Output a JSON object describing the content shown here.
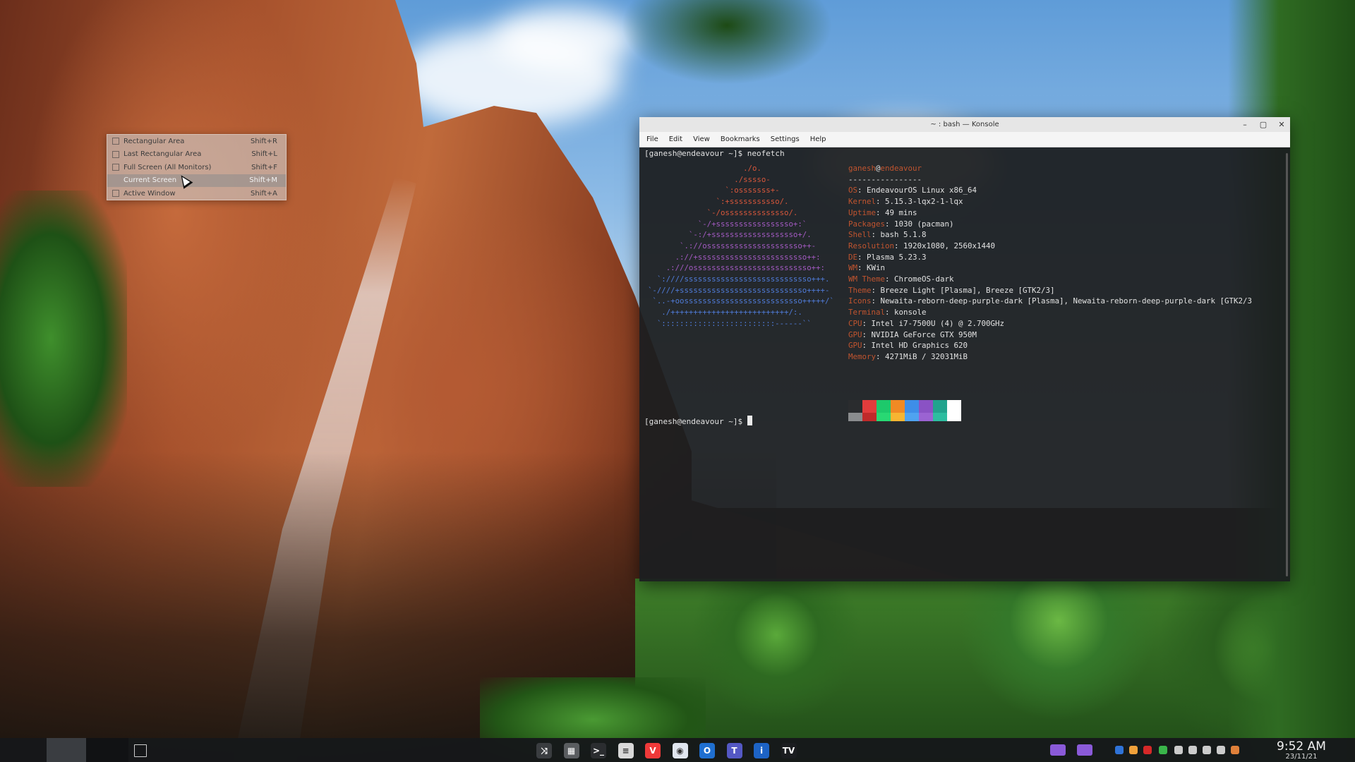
{
  "spectacle_menu": {
    "items": [
      {
        "label": "Rectangular Area",
        "shortcut": "Shift+R"
      },
      {
        "label": "Last Rectangular Area",
        "shortcut": "Shift+L"
      },
      {
        "label": "Full Screen (All Monitors)",
        "shortcut": "Shift+F"
      },
      {
        "label": "Current Screen",
        "shortcut": "Shift+M",
        "highlighted": true
      },
      {
        "label": "Active Window",
        "shortcut": "Shift+A"
      }
    ]
  },
  "konsole": {
    "title": "~ : bash — Konsole",
    "menu": [
      "File",
      "Edit",
      "View",
      "Bookmarks",
      "Settings",
      "Help"
    ],
    "prompt1": "[ganesh@endeavour ~]$ neofetch",
    "prompt2": "[ganesh@endeavour ~]$ ",
    "user": "ganesh",
    "host": "endeavour",
    "separator": "----------------",
    "info": [
      {
        "key": "OS",
        "value": "EndeavourOS Linux x86_64"
      },
      {
        "key": "Kernel",
        "value": "5.15.3-lqx2-1-lqx"
      },
      {
        "key": "Uptime",
        "value": "49 mins"
      },
      {
        "key": "Packages",
        "value": "1030 (pacman)"
      },
      {
        "key": "Shell",
        "value": "bash 5.1.8"
      },
      {
        "key": "Resolution",
        "value": "1920x1080, 2560x1440"
      },
      {
        "key": "DE",
        "value": "Plasma 5.23.3"
      },
      {
        "key": "WM",
        "value": "KWin"
      },
      {
        "key": "WM Theme",
        "value": "ChromeOS-dark"
      },
      {
        "key": "Theme",
        "value": "Breeze Light [Plasma], Breeze [GTK2/3]"
      },
      {
        "key": "Icons",
        "value": "Newaita-reborn-deep-purple-dark [Plasma], Newaita-reborn-deep-purple-dark [GTK2/3"
      },
      {
        "key": "Terminal",
        "value": "konsole"
      },
      {
        "key": "CPU",
        "value": "Intel i7-7500U (4) @ 2.700GHz"
      },
      {
        "key": "GPU",
        "value": "NVIDIA GeForce GTX 950M"
      },
      {
        "key": "GPU",
        "value": "Intel HD Graphics 620"
      },
      {
        "key": "Memory",
        "value": "4271MiB / 32031MiB"
      }
    ],
    "ascii_art": [
      "                     ./o.",
      "                   ./sssso-",
      "                 `:osssssss+-",
      "               `:+sssssssssso/.",
      "             `-/ossssssssssssso/.",
      "           `-/+sssssssssssssssso+:`",
      "         `-:/+sssssssssssssssssso+/.",
      "       `.://osssssssssssssssssssso++-",
      "      .://+ssssssssssssssssssssssso++:",
      "    .:///ossssssssssssssssssssssssso++:",
      "  `:////ssssssssssssssssssssssssssso+++.",
      "`-////+ssssssssssssssssssssssssssso++++-",
      " `..-+oossssssssssssssssssssssssso+++++/`",
      "   ./++++++++++++++++++++++++++/:.",
      "  `:::::::::::::::::::::::::------``"
    ],
    "color_blocks": {
      "top": [
        "#2a2c2e",
        "#e23c3c",
        "#1dc96b",
        "#f08a24",
        "#3e8ee8",
        "#8a52c4",
        "#22a38d",
        "#ffffff"
      ],
      "bottom": [
        "#8a8c8e",
        "#c02a2a",
        "#28d873",
        "#f7b532",
        "#4fa3f0",
        "#9b63d2",
        "#2dbda0",
        "#ffffff"
      ]
    }
  },
  "taskbar": {
    "apps": [
      {
        "name": "overview-icon",
        "color": "#3a3d40",
        "glyph": "⤨"
      },
      {
        "name": "system-monitor-icon",
        "color": "#5a5d60",
        "glyph": "▦"
      },
      {
        "name": "konsole-icon",
        "color": "#2b2d30",
        "glyph": ">_"
      },
      {
        "name": "notes-icon",
        "color": "#d8d8d8",
        "glyph": "≡"
      },
      {
        "name": "vivaldi-icon",
        "color": "#ef3939",
        "glyph": "V"
      },
      {
        "name": "browser-icon",
        "color": "#e0e6ef",
        "glyph": "◉"
      },
      {
        "name": "outlook-icon",
        "color": "#1f6fd0",
        "glyph": "O"
      },
      {
        "name": "teams-icon",
        "color": "#5458c4",
        "glyph": "T"
      },
      {
        "name": "info-icon",
        "color": "#1d63c5",
        "glyph": "i"
      },
      {
        "name": "tradingview-icon",
        "color": "#1b1d20",
        "glyph": "TV"
      }
    ],
    "tray": [
      "#8a5ad8",
      "#8a5ad8",
      "#2f73d8",
      "#f0a13a",
      "#d62828",
      "#39b54a",
      "#cccccc",
      "#cccccc",
      "#cccccc",
      "#cccccc",
      "#e0803a"
    ],
    "time": "9:52 AM",
    "date": "23/11/21"
  }
}
